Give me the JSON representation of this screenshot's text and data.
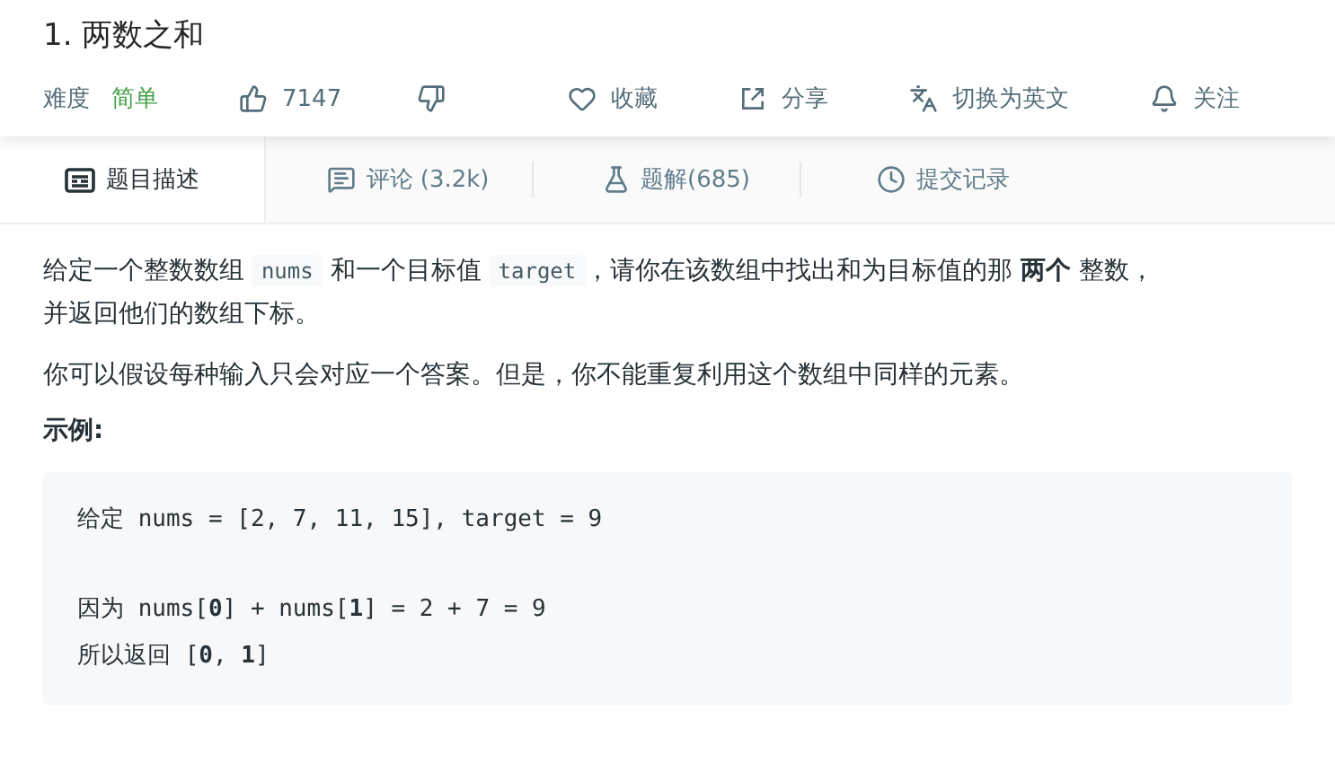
{
  "title": "1. 两数之和",
  "meta": {
    "difficulty_label": "难度",
    "difficulty": "简单",
    "actions": [
      {
        "kind": "like",
        "label": "7147"
      },
      {
        "kind": "dislike"
      },
      {
        "kind": "favorite",
        "label": "收藏"
      },
      {
        "kind": "share",
        "label": "分享"
      },
      {
        "kind": "translate",
        "label": "切换为英文"
      },
      {
        "kind": "follow",
        "label": "关注"
      }
    ]
  },
  "tabs": [
    {
      "kind": "description",
      "label": "题目描述",
      "selected": true
    },
    {
      "kind": "comments",
      "label": "评论 (3.2k)",
      "selected": false
    },
    {
      "kind": "solutions",
      "label": "题解(685)",
      "selected": false
    },
    {
      "kind": "submissions",
      "label": "提交记录",
      "selected": false
    }
  ],
  "paragraphs": [
    [
      {
        "kind": "text",
        "text": "给定一个整数数组 "
      },
      {
        "kind": "code",
        "text": "nums"
      },
      {
        "kind": "text",
        "text": " 和一个目标值 "
      },
      {
        "kind": "code",
        "text": "target"
      },
      {
        "kind": "text",
        "text": "，请你在该数组中找出和为目标值的那 **两个** 整数，并返回他们的数组下标。"
      }
    ],
    [
      {
        "kind": "text",
        "text": "你可以假设每种输入只会对应一个答案。但是，你不能重复利用这个数组中同样的元素。"
      }
    ]
  ],
  "example_heading": "示例:",
  "example_blocks": [
    [
      "给定 nums = [2, 7, 11, 15], target = 9"
    ],
    [
      "因为 nums[**0**] + nums[**1**] = 2 + 7 = 9",
      "所以返回 [**0**, **1**]"
    ]
  ]
}
